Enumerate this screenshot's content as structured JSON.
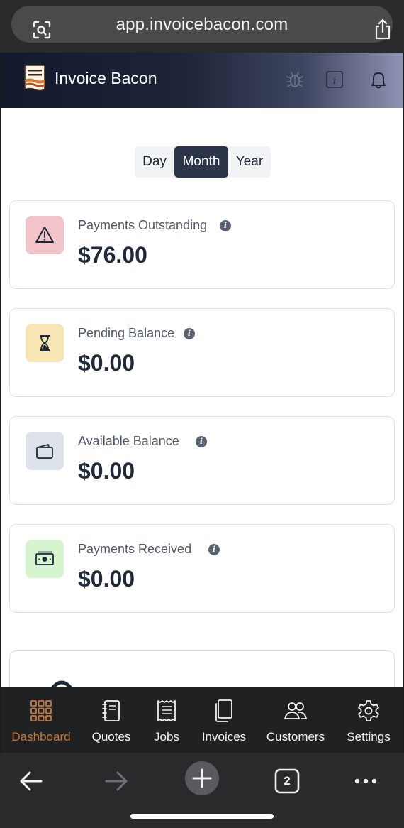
{
  "browser": {
    "url": "app.invoicebacon.com",
    "tab_count": "2"
  },
  "header": {
    "brand": "Invoice Bacon"
  },
  "period_toggle": {
    "day": "Day",
    "month": "Month",
    "year": "Year",
    "selected": "Month"
  },
  "cards": [
    {
      "label": "Payments Outstanding",
      "value": "$76.00",
      "icon": "warning-icon",
      "icon_bg": "#f0c4c8"
    },
    {
      "label": "Pending Balance",
      "value": "$0.00",
      "icon": "hourglass-icon",
      "icon_bg": "#f7e6b3"
    },
    {
      "label": "Available Balance",
      "value": "$0.00",
      "icon": "wallet-icon",
      "icon_bg": "#dde2ea"
    },
    {
      "label": "Payments Received",
      "value": "$0.00",
      "icon": "cash-icon",
      "icon_bg": "#d6f5cf"
    }
  ],
  "tabs": [
    {
      "label": "Dashboard",
      "icon": "grid-icon",
      "active": true
    },
    {
      "label": "Quotes",
      "icon": "notebook-icon"
    },
    {
      "label": "Jobs",
      "icon": "receipt-icon"
    },
    {
      "label": "Invoices",
      "icon": "documents-icon"
    },
    {
      "label": "Customers",
      "icon": "users-icon"
    },
    {
      "label": "Settings",
      "icon": "gear-icon"
    }
  ],
  "colors": {
    "accent": "#c8773a",
    "dark": "#2b3448"
  }
}
